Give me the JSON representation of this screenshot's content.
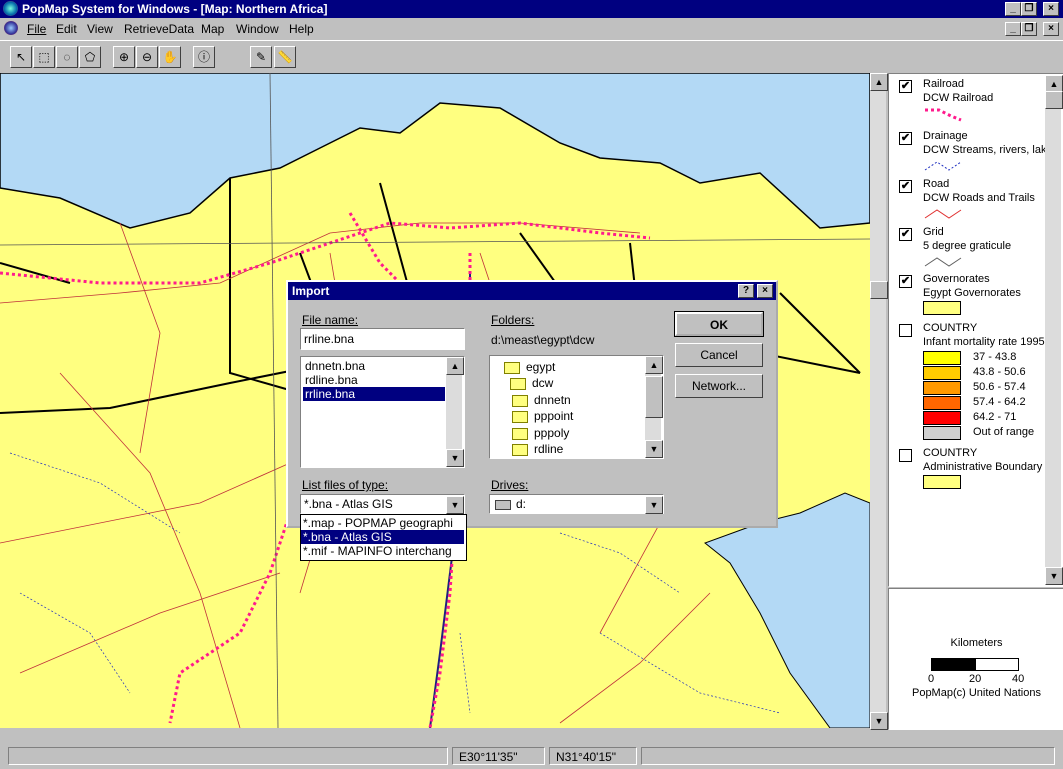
{
  "app": {
    "title": "PopMap System for Windows - [Map: Northern Africa]",
    "colors": {
      "titlebar": "#000080",
      "land": "#ffff80",
      "sea": "#b3d9f5",
      "railroad": "#ff1a8c"
    }
  },
  "menu": {
    "items": [
      {
        "label": "File"
      },
      {
        "label": "Edit"
      },
      {
        "label": "View"
      },
      {
        "label": "RetrieveData"
      },
      {
        "label": "Map"
      },
      {
        "label": "Window"
      },
      {
        "label": "Help"
      }
    ]
  },
  "toolbar": {
    "icons": [
      "pointer-icon",
      "select-rect-icon",
      "select-circle-icon",
      "select-polygon-icon",
      "zoom-in-icon",
      "zoom-out-icon",
      "pan-hand-icon",
      "info-icon",
      "label-icon",
      "ruler-icon"
    ]
  },
  "legend": {
    "layers": [
      {
        "checked": "✔",
        "name": "Railroad",
        "sub": "DCW Railroad"
      },
      {
        "checked": "✔",
        "name": "Drainage",
        "sub": "DCW Streams, rivers, lak"
      },
      {
        "checked": "✔",
        "name": "Road",
        "sub": "DCW Roads and Trails"
      },
      {
        "checked": "✔",
        "name": "Grid",
        "sub": "5 degree graticule"
      },
      {
        "checked": "✔",
        "name": "Governorates",
        "sub": "Egypt Governorates"
      },
      {
        "checked": "",
        "name": "COUNTRY",
        "sub": "Infant mortality rate 1995"
      },
      {
        "checked": "",
        "name": "COUNTRY",
        "sub": "Administrative Boundary"
      }
    ],
    "ranges": [
      {
        "label": "37    - 43.8",
        "color": "#ffff00"
      },
      {
        "label": "43.8 - 50.6",
        "color": "#ffcc00"
      },
      {
        "label": "50.6 - 57.4",
        "color": "#ff9900"
      },
      {
        "label": "57.4 - 64.2",
        "color": "#ff6600"
      },
      {
        "label": "64.2 - 71",
        "color": "#ff0000"
      },
      {
        "label": "Out of range",
        "color": "#d0d0d0"
      }
    ]
  },
  "scale": {
    "title": "Kilometers",
    "ticks": [
      "0",
      "20",
      "40"
    ],
    "credit": "PopMap(c) United Nations"
  },
  "status": {
    "longitude": "E30°11'35\"",
    "latitude": "N31°40'15\""
  },
  "dialog": {
    "title": "Import",
    "help_btn": "?",
    "close_btn": "×",
    "filename_label": "File name:",
    "filename_value": "rrline.bna",
    "files": [
      "dnnetn.bna",
      "rdline.bna",
      "rrline.bna"
    ],
    "folders_label": "Folders:",
    "folders_path": "d:\\meast\\egypt\\dcw",
    "folder_tree": [
      "egypt",
      "dcw",
      "dnnetn",
      "pppoint",
      "pppoly",
      "rdline"
    ],
    "ok": "OK",
    "cancel": "Cancel",
    "network": "Network...",
    "filetype_label": "List files of type:",
    "filetype_value": "*.bna - Atlas GIS",
    "filetype_options": [
      "*.map - POPMAP geographi",
      "*.bna - Atlas GIS",
      "*.mif - MAPINFO interchang"
    ],
    "drives_label": "Drives:",
    "drives_value": "d:"
  }
}
